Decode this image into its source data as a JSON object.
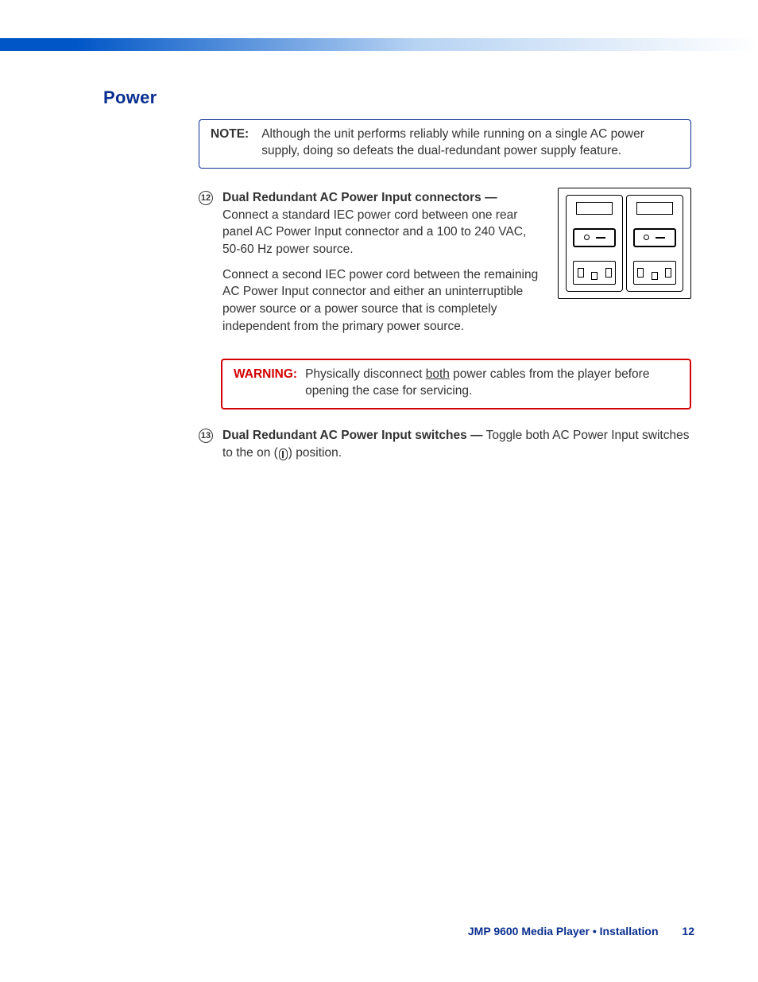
{
  "section_title": "Power",
  "note": {
    "label": "NOTE:",
    "text": "Although the unit performs reliably while running on a single AC power supply, doing so defeats the dual-redundant power supply feature."
  },
  "item12": {
    "num": "12",
    "title": "Dual Redundant AC Power Input connectors —",
    "para1": "Connect a standard IEC power cord between one rear panel AC Power Input connector and a 100 to 240 VAC, 50-60 Hz power source.",
    "para2": "Connect a second IEC power cord between the remaining AC Power Input connector and either an uninterruptible power source or a power source that is completely independent from the primary power source."
  },
  "warning": {
    "label": "WARNING:",
    "pre": "Physically disconnect ",
    "underlined": "both",
    "post": " power cables from the player before opening the case for servicing."
  },
  "item13": {
    "num": "13",
    "title": "Dual Redundant AC Power Input switches —",
    "text_a": " Toggle both AC Power Input switches to the on (",
    "text_b": ") position."
  },
  "footer": {
    "text": "JMP 9600 Media Player • Installation",
    "page": "12"
  }
}
